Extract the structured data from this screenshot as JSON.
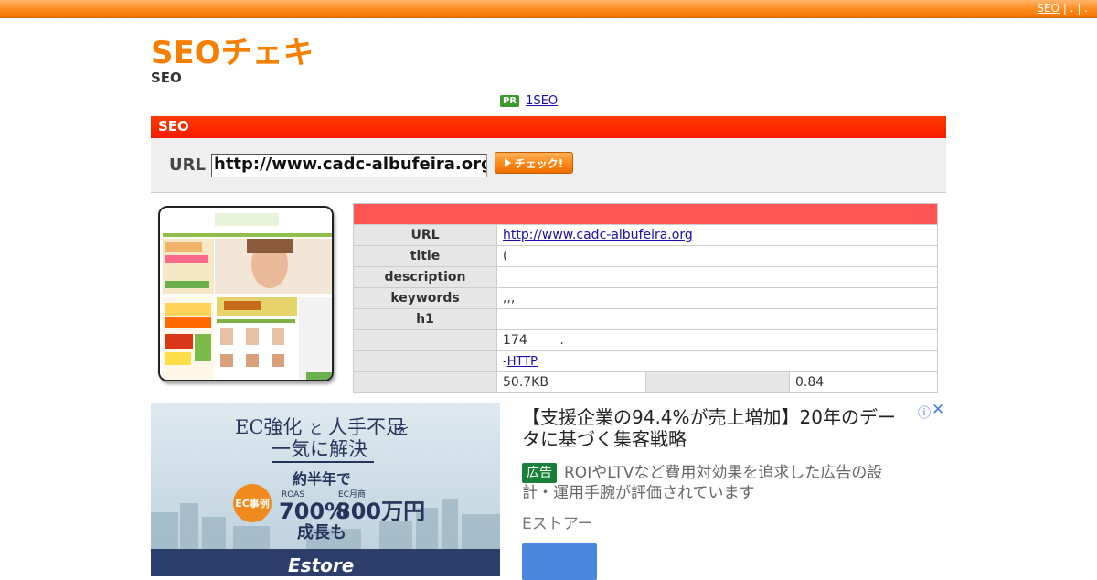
{
  "topbar": {
    "links_text": "SEO",
    "separators": "|  .  |  ."
  },
  "header": {
    "logo_text": "SEOチェキ!",
    "tagline": "SEO"
  },
  "pr": {
    "badge": "PR",
    "link_text": "1SEO"
  },
  "section": {
    "title": "SEO"
  },
  "url_form": {
    "label": "URL",
    "value": "http://www.cadc-albufeira.org",
    "button_label": "チェック!"
  },
  "thumbnail": {
    "alt": "site screenshot"
  },
  "info_table": {
    "rows": [
      {
        "label": "URL",
        "value": "http://www.cadc-albufeira.org",
        "is_link": true
      },
      {
        "label": "title",
        "value": "("
      },
      {
        "label": "description",
        "value": ""
      },
      {
        "label": "keywords",
        "value": ",,,"
      },
      {
        "label": "h1",
        "value": ""
      },
      {
        "label": "",
        "value": "174        ."
      },
      {
        "label": "",
        "value_prefix": "-",
        "value_link": "HTTP"
      }
    ],
    "last_row": {
      "size": "50.7KB",
      "ratio": "0.84"
    }
  },
  "ad": {
    "image_heading_1": "EC強化",
    "image_heading_1b": "と",
    "image_heading_2": "人手不足",
    "image_heading_2b": "を",
    "image_heading_3": "一気に解決",
    "image_sub": "約半年で",
    "image_badge": "EC事例",
    "image_roas_label": "ROAS",
    "image_roas_value": "700%",
    "image_ec_label": "EC月商",
    "image_ec_value": "800万円",
    "image_growth": "成長も",
    "image_brand": "Estore",
    "title": "【支援企業の94.4%が売上増加】20年のデータに基づく集客戦略",
    "badge": "広告",
    "description": "ROIやLTVなど費用対効果を追求した広告の設計・運用手腕が評価されています",
    "sponsor": "Eストアー",
    "info_icon": "ⓘ",
    "close_icon": "✕"
  },
  "colors": {
    "orange": "#ff8a1c",
    "red_bar": "#f81b00",
    "table_head": "#ff5555",
    "ad_green": "#188038"
  }
}
